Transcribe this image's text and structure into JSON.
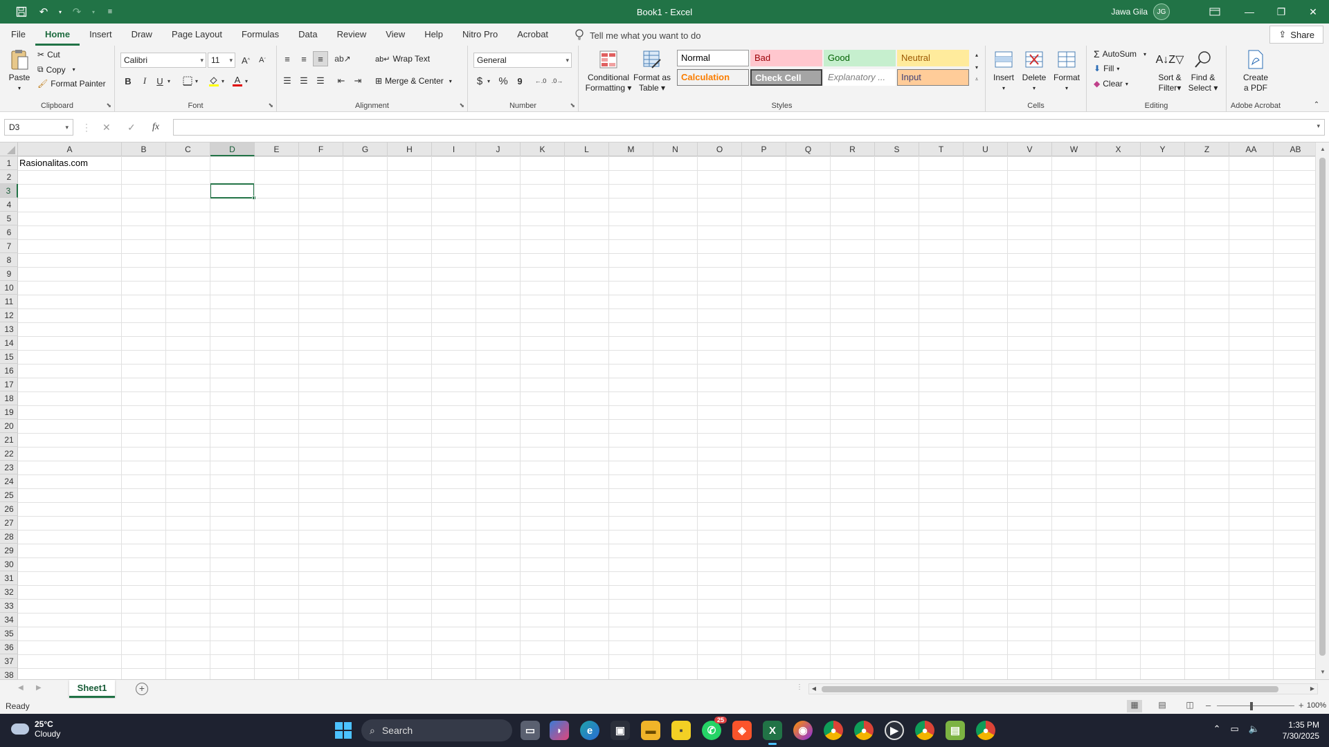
{
  "window": {
    "title": "Book1  -  Excel",
    "user_name": "Jawa Gila",
    "user_initials": "JG",
    "accent_color": "#217346"
  },
  "qat": {
    "save_icon": "save-icon",
    "undo_icon": "undo-icon",
    "redo_icon": "redo-icon",
    "customize_icon": "customize-icon"
  },
  "tabs": [
    {
      "label": "File"
    },
    {
      "label": "Home"
    },
    {
      "label": "Insert"
    },
    {
      "label": "Draw"
    },
    {
      "label": "Page Layout"
    },
    {
      "label": "Formulas"
    },
    {
      "label": "Data"
    },
    {
      "label": "Review"
    },
    {
      "label": "View"
    },
    {
      "label": "Help"
    },
    {
      "label": "Nitro Pro"
    },
    {
      "label": "Acrobat"
    }
  ],
  "active_tab": "Home",
  "tell_me": "Tell me what you want to do",
  "share_label": "Share",
  "ribbon": {
    "clipboard": {
      "label": "Clipboard",
      "paste": "Paste",
      "cut": "Cut",
      "copy": "Copy",
      "format_painter": "Format Painter"
    },
    "font": {
      "label": "Font",
      "name": "Calibri",
      "size": "11",
      "bold": "B",
      "italic": "I",
      "underline": "U",
      "font_color_letter": "A"
    },
    "alignment": {
      "label": "Alignment",
      "wrap_text": "Wrap Text",
      "merge_center": "Merge & Center"
    },
    "number": {
      "label": "Number",
      "format": "General",
      "currency": "$",
      "percent": "%",
      "comma": "9"
    },
    "styles": {
      "label": "Styles",
      "conditional_formatting": [
        "Conditional",
        "Formatting"
      ],
      "format_as_table": [
        "Format as",
        "Table"
      ],
      "cells": [
        {
          "label": "Normal",
          "bg": "#ffffff",
          "fg": "#000000",
          "border": "#9a9a9a"
        },
        {
          "label": "Bad",
          "bg": "#ffc7ce",
          "fg": "#9c0006",
          "border": "#ffc7ce"
        },
        {
          "label": "Good",
          "bg": "#c6efce",
          "fg": "#006100",
          "border": "#c6efce"
        },
        {
          "label": "Neutral",
          "bg": "#ffeb9c",
          "fg": "#9c5700",
          "border": "#ffeb9c"
        },
        {
          "label": "Calculation",
          "bg": "#f2f2f2",
          "fg": "#fa7d00",
          "border": "#7f7f7f"
        },
        {
          "label": "Check Cell",
          "bg": "#a5a5a5",
          "fg": "#ffffff",
          "border": "#3f3f3f"
        },
        {
          "label": "Explanatory ...",
          "bg": "#ffffff",
          "fg": "#7f7f7f",
          "border": "#ffffff"
        },
        {
          "label": "Input",
          "bg": "#ffcc99",
          "fg": "#3f3f76",
          "border": "#7f7f7f"
        }
      ]
    },
    "cells": {
      "label": "Cells",
      "insert": "Insert",
      "delete": "Delete",
      "format": "Format"
    },
    "editing": {
      "label": "Editing",
      "autosum": "AutoSum",
      "fill": "Fill",
      "clear": "Clear",
      "sort_filter": [
        "Sort &",
        "Filter"
      ],
      "find_select": [
        "Find &",
        "Select"
      ]
    },
    "acrobat": {
      "label": "Adobe Acrobat",
      "create_pdf": [
        "Create",
        "a PDF"
      ]
    }
  },
  "formula_bar": {
    "name_box": "D3",
    "formula": "",
    "fx": "fx",
    "cancel": "✕",
    "enter": "✓"
  },
  "grid": {
    "columns": [
      "A",
      "B",
      "C",
      "D",
      "E",
      "F",
      "G",
      "H",
      "I",
      "J",
      "K",
      "L",
      "M",
      "N",
      "O",
      "P",
      "Q",
      "R",
      "S",
      "T",
      "U",
      "V",
      "W",
      "X",
      "Y",
      "Z",
      "AA",
      "AB"
    ],
    "rows": 38,
    "selected_column": "D",
    "selected_row": 3,
    "cell_a1": "Rasionalitas.com"
  },
  "sheets": [
    {
      "name": "Sheet1",
      "active": true
    }
  ],
  "status": {
    "text": "Ready",
    "zoom": "100%"
  },
  "taskbar": {
    "weather_temp": "25°C",
    "weather_desc": "Cloudy",
    "search_placeholder": "Search",
    "whatsapp_badge": "25",
    "time": "1:35 PM",
    "date": "7/30/2025"
  }
}
